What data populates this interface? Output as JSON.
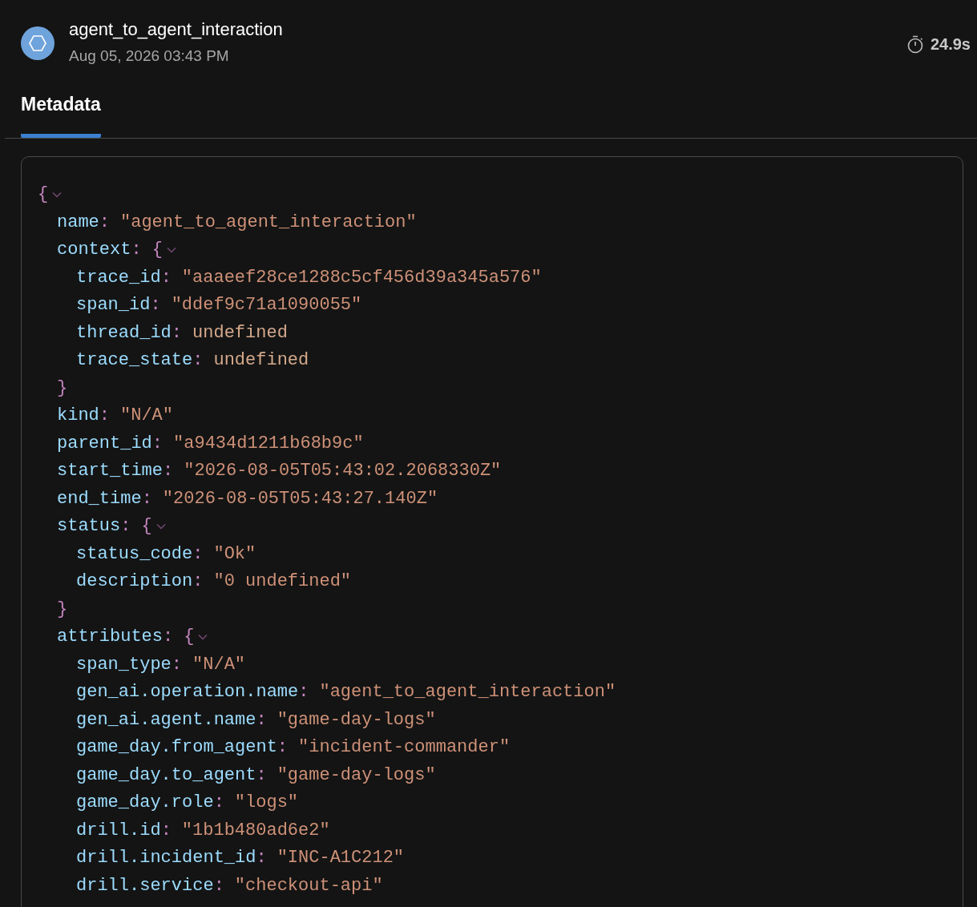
{
  "header": {
    "title": "agent_to_agent_interaction",
    "timestamp": "Aug 05, 2026 03:43 PM",
    "duration": "24.9s"
  },
  "tabs": [
    {
      "label": "Metadata",
      "selected": true
    }
  ],
  "metadata": {
    "open": "{",
    "expanded": true,
    "children": [
      {
        "key": "name",
        "colon": ":",
        "kind": "string",
        "value": "\"agent_to_agent_interaction\""
      },
      {
        "key": "context",
        "colon": ":",
        "kind": "object",
        "open": "{",
        "close": "}",
        "expanded": true,
        "children": [
          {
            "key": "trace_id",
            "colon": ":",
            "kind": "string",
            "value": "\"aaaeef28ce1288c5cf456d39a345a576\""
          },
          {
            "key": "span_id",
            "colon": ":",
            "kind": "string",
            "value": "\"ddef9c71a1090055\""
          },
          {
            "key": "thread_id",
            "colon": ":",
            "kind": "undefined",
            "value": "undefined"
          },
          {
            "key": "trace_state",
            "colon": ":",
            "kind": "undefined",
            "value": "undefined"
          }
        ]
      },
      {
        "key": "kind",
        "colon": ":",
        "kind": "string",
        "value": "\"N/A\""
      },
      {
        "key": "parent_id",
        "colon": ":",
        "kind": "string",
        "value": "\"a9434d1211b68b9c\""
      },
      {
        "key": "start_time",
        "colon": ":",
        "kind": "string",
        "value": "\"2026-08-05T05:43:02.2068330Z\""
      },
      {
        "key": "end_time",
        "colon": ":",
        "kind": "string",
        "value": "\"2026-08-05T05:43:27.140Z\""
      },
      {
        "key": "status",
        "colon": ":",
        "kind": "object",
        "open": "{",
        "close": "}",
        "expanded": true,
        "children": [
          {
            "key": "status_code",
            "colon": ":",
            "kind": "string",
            "value": "\"Ok\""
          },
          {
            "key": "description",
            "colon": ":",
            "kind": "string",
            "value": "\"0 undefined\""
          }
        ]
      },
      {
        "key": "attributes",
        "colon": ":",
        "kind": "object",
        "open": "{",
        "expanded": true,
        "children": [
          {
            "key": "span_type",
            "colon": ":",
            "kind": "string",
            "value": "\"N/A\""
          },
          {
            "key": "gen_ai.operation.name",
            "colon": ":",
            "kind": "string",
            "value": "\"agent_to_agent_interaction\""
          },
          {
            "key": "gen_ai.agent.name",
            "colon": ":",
            "kind": "string",
            "value": "\"game-day-logs\""
          },
          {
            "key": "game_day.from_agent",
            "colon": ":",
            "kind": "string",
            "value": "\"incident-commander\""
          },
          {
            "key": "game_day.to_agent",
            "colon": ":",
            "kind": "string",
            "value": "\"game-day-logs\""
          },
          {
            "key": "game_day.role",
            "colon": ":",
            "kind": "string",
            "value": "\"logs\""
          },
          {
            "key": "drill.id",
            "colon": ":",
            "kind": "string",
            "value": "\"1b1b480ad6e2\""
          },
          {
            "key": "drill.incident_id",
            "colon": ":",
            "kind": "string",
            "value": "\"INC-A1C212\""
          },
          {
            "key": "drill.service",
            "colon": ":",
            "kind": "string",
            "value": "\"checkout-api\""
          }
        ]
      }
    ]
  }
}
